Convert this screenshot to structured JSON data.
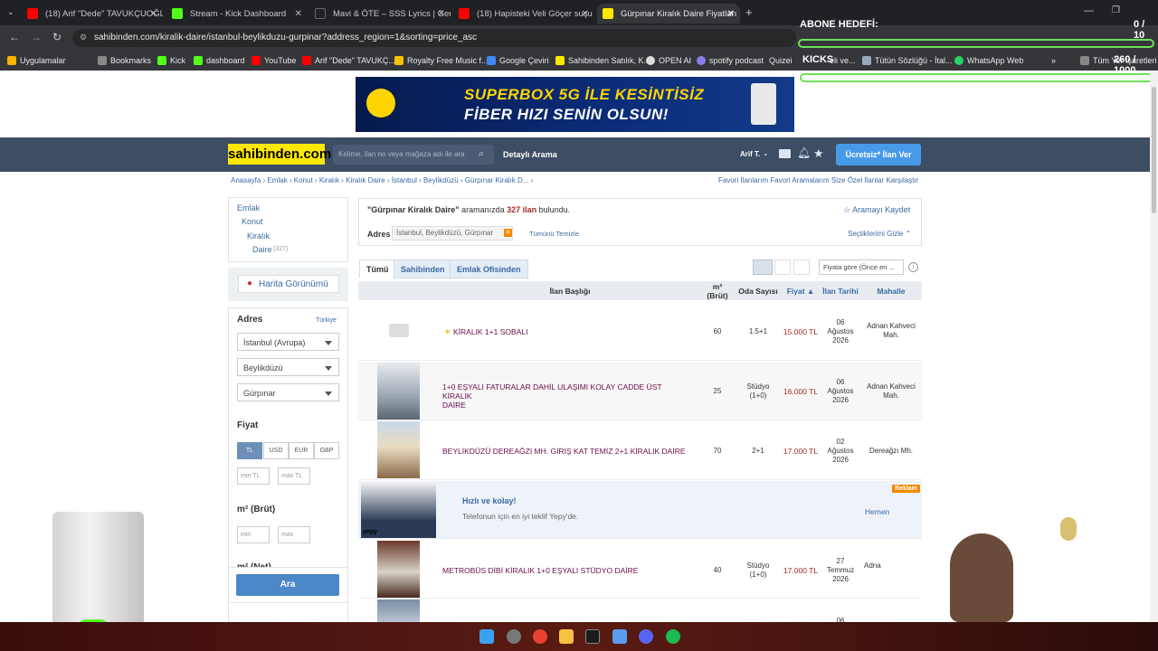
{
  "browser": {
    "tabs": [
      {
        "label": "(18) Arif \"Dede\" TAVUKÇUOĞLU",
        "color": "#ff0000"
      },
      {
        "label": "Stream - Kick Dashboard",
        "color": "#53fc18"
      },
      {
        "label": "Mavi & ÖTE – SSS Lyrics | Genius",
        "color": "#ffff64"
      },
      {
        "label": "(18) Hapisteki Veli Göçer suçu b",
        "color": "#ff0000"
      },
      {
        "label": "Gürpınar Kiralık Daire Fiyatları",
        "color": "#ffe800"
      }
    ],
    "url": "sahibinden.com/kiralik-daire/istanbul-beylikduzu-gurpinar?address_region=1&sorting=price_asc",
    "bookmarks": [
      "Uygulamalar",
      "Bookmarks",
      "Kick",
      "dashboard",
      "YouTube",
      "Arif \"Dede\" TAVUKÇ...",
      "Royalty Free Music f...",
      "Google Çeviri",
      "Sahibinden Satılık, K...",
      "OPEN AI",
      "spotify podcast",
      "Quizei",
      "eli ve...",
      "Tütün Sözlüğü - İtal...",
      "WhatsApp Web",
      "Tüm Yer İşaretleri"
    ]
  },
  "overlay": {
    "abone_label": "ABONE HEDEFİ:",
    "abone_count": "0 / 10",
    "kicks_label": "KICKS",
    "kicks_count": "260 / 1000"
  },
  "banner": {
    "line1": "SUPERBOX 5G İLE KESİNTİSİZ",
    "line2": "FİBER HIZI SENİN OLSUN!"
  },
  "header": {
    "logo": "sahibinden.com",
    "search_placeholder": "Kelime, ilan no veya mağaza adı ile ara",
    "detayli": "Detaylı Arama",
    "user": "Arif T.",
    "ilan_ver": "Ücretsiz* İlan Ver"
  },
  "breadcrumb": "Anasayfa  ›  Emlak  ›  Konut  ›  Kiralık  ›  Kiralık Daire  ›  İstanbul  ›  Beylikdüzü  ›  Gürpınar Kiralık D...  ›",
  "toplinks": "Favori İlanlarım    Favori Aramalarım    Size Özel İlanlar    Karşılaştır",
  "categories": {
    "emlak": "Emlak",
    "konut": "Konut",
    "kiralik": "Kiralık",
    "daire": "Daire",
    "daire_count": "(327)"
  },
  "map_button": "Harita Görünümü",
  "filters": {
    "adres_title": "Adres",
    "turkiye": "Türkiye",
    "il": "İstanbul (Avrupa)",
    "ilce": "Beylikdüzü",
    "mahalle": "Gürpınar",
    "fiyat_title": "Fiyat",
    "currencies": [
      "TL",
      "USD",
      "EUR",
      "GBP"
    ],
    "min_tl": "min TL",
    "max_tl": "max TL",
    "m2_title": "m² (Brüt)",
    "min": "min",
    "max": "max",
    "m2net_title": "m² (Net)",
    "ara": "Ara"
  },
  "results": {
    "query": "\"Gürpınar Kiralık Daire\"",
    "text_mid": " aramanızda ",
    "count": "327 ilan",
    "text_end": " bulundu.",
    "kaydet": "☆ Aramayı Kaydet",
    "adres_label": "Adres",
    "chip": "İstanbul, Beylikdüzü, Gürpınar",
    "temizle": "Tümünü Temizle",
    "gizle": "Seçtiklerimi Gizle ⌃"
  },
  "tabs": [
    "Tümü",
    "Sahibinden",
    "Emlak Ofisinden"
  ],
  "sort": "Fiyata göre (Önce en ...",
  "columns": {
    "baslik": "İlan Başlığı",
    "m2": "m²",
    "m2b": "(Brüt)",
    "oda": "Oda Sayısı",
    "fiyat": "Fiyat ▲",
    "tarih": "İlan Tarihi",
    "mahalle": "Mahalle"
  },
  "listings": [
    {
      "title": "KİRALIK 1+1 SOBALI",
      "m2": "60",
      "oda": "1.5+1",
      "oda2": "",
      "price": "15.000 TL",
      "d1": "06",
      "d2": "Ağustos",
      "d3": "2026",
      "mah": "Adnan Kahveci",
      "mah2": "Mah."
    },
    {
      "title": "1+0 EŞYALI FATURALAR DAHİL ULAŞIMI KOLAY CADDE ÜST KİRALIK",
      "title2": "DAİRE",
      "m2": "25",
      "oda": "Stüdyo",
      "oda2": "(1+0)",
      "price": "16.000 TL",
      "d1": "06",
      "d2": "Ağustos",
      "d3": "2026",
      "mah": "Adnan Kahveci",
      "mah2": "Mah."
    },
    {
      "title": "BEYLİKDÜZÜ DEREAĞZI MH. GİRİŞ KAT TEMİZ 2+1 KİRALIK DAİRE",
      "m2": "70",
      "oda": "2+1",
      "oda2": "",
      "price": "17.000 TL",
      "d1": "02",
      "d2": "Ağustos",
      "d3": "2026",
      "mah": "Dereağzı Mh.",
      "mah2": ""
    },
    {
      "title": "METROBÜS DİBİ KİRALIK 1+0 EŞYALI STÜDYO DAİRE",
      "m2": "40",
      "oda": "Stüdyo",
      "oda2": "(1+0)",
      "price": "17.000 TL",
      "d1": "27",
      "d2": "Temmuz",
      "d3": "2026",
      "mah": "Adna",
      "mah2": ""
    }
  ],
  "ad": {
    "title": "Hızlı ve kolay!",
    "text": "Telefonun için en iyi teklif Yepy'de.",
    "badge": "Reklam",
    "brand": "yepy",
    "cta": "Hemen"
  },
  "next_date": "06"
}
